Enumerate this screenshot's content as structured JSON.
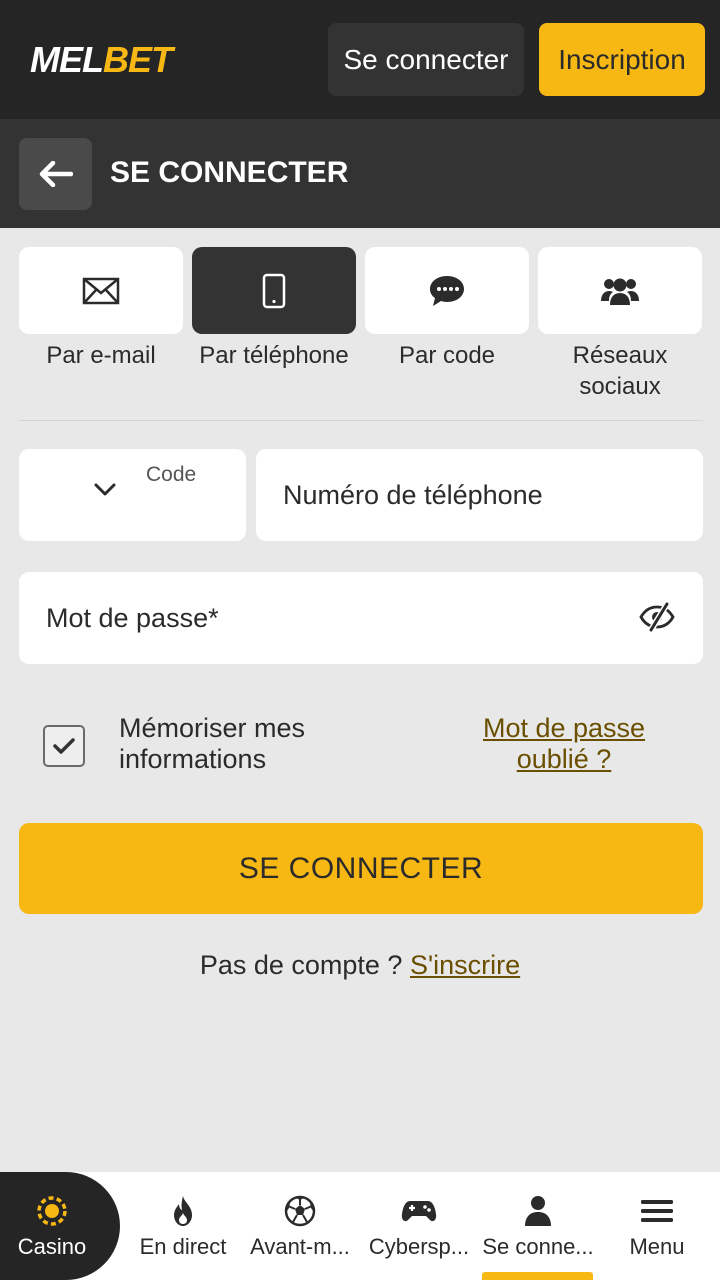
{
  "header": {
    "logo_part1": "MEL",
    "logo_part2": "BET",
    "login_label": "Se connecter",
    "register_label": "Inscription"
  },
  "subheader": {
    "title": "SE CONNECTER",
    "back_icon": "arrow-left-icon"
  },
  "tabs": [
    {
      "label": "Par e-mail",
      "icon": "envelope-icon",
      "active": false
    },
    {
      "label": "Par téléphone",
      "icon": "smartphone-icon",
      "active": true
    },
    {
      "label": "Par code",
      "icon": "chat-bubble-icon",
      "active": false
    },
    {
      "label": "Réseaux sociaux",
      "icon": "users-icon",
      "active": false
    }
  ],
  "form": {
    "code_label": "Code",
    "phone_placeholder": "Numéro de téléphone",
    "password_placeholder": "Mot de passe*",
    "remember_label": "Mémoriser mes informations",
    "remember_checked": true,
    "forgot_label": "Mot de passe oublié ?",
    "submit_label": "SE CONNECTER",
    "no_account_text": "Pas de compte ?",
    "signup_link": "S'inscrire"
  },
  "bottom_nav": [
    {
      "label": "Casino",
      "icon": "casino-chip-icon"
    },
    {
      "label": "En direct",
      "icon": "flame-icon"
    },
    {
      "label": "Avant-m...",
      "icon": "soccer-ball-icon"
    },
    {
      "label": "Cybersp...",
      "icon": "gamepad-icon"
    },
    {
      "label": "Se conne...",
      "icon": "user-icon",
      "active": true
    },
    {
      "label": "Menu",
      "icon": "hamburger-menu-icon"
    }
  ],
  "colors": {
    "accent": "#f8b813",
    "dark": "#252525",
    "link": "#6b4f00"
  }
}
